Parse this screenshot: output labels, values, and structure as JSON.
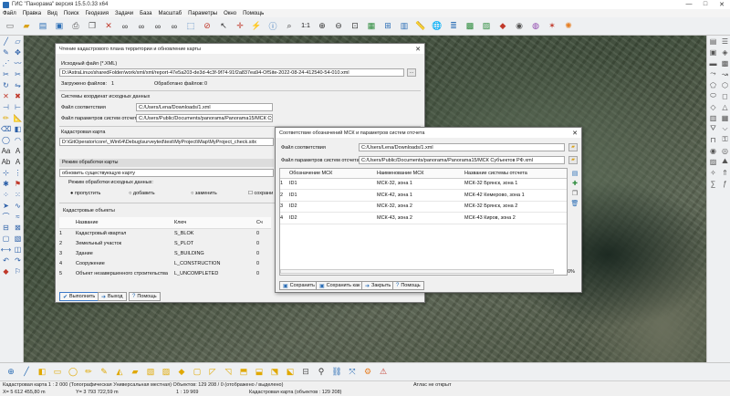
{
  "window": {
    "title": "ГИС \"Панорама\" версия 15.5.0.33 x64",
    "controls": [
      "—",
      "□",
      "✕"
    ]
  },
  "menu": [
    "Файл",
    "Правка",
    "Вид",
    "Поиск",
    "Геодезия",
    "Задачи",
    "База",
    "Масштаб",
    "Параметры",
    "Окно",
    "Помощь"
  ],
  "toolbar": {
    "scale_label": "1:1"
  },
  "dialog1": {
    "title": "Чтение кадастрового плана территории и обновление карты",
    "source_files_label": "Исходный файл (*.XML)",
    "source_file_value": "D:/AstraLinux/sharedFolder/work/xml/xml/report-47e5a203-de3d-4c3f-9f74-91f2a837ea94-OfSite-2022-08-24-412540-54-010.xml",
    "loaded_files_label": "Загружено файлов:",
    "loaded_files_value": "1",
    "processed_files_label": "Обработано файлов:",
    "processed_files_value": "0",
    "crs_section": "Системы координат исходных данных",
    "match_file_label": "Файл соответствия",
    "match_file_value": "C:/Users/Lena/Downloads/1.xml",
    "params_file_label": "Файл параметров систем отсчета",
    "params_file_value": "C:/Users/Public/Documents/panorama/Panorama15/МСК Субъектов РФ.xml",
    "cadastral_map_label": "Кадастровая карта",
    "cadastral_map_value": "D:\\GitOperator\\core\\_Win64\\Debug\\surveyted\\test\\MyProject\\Map\\MyProject_check.sitx",
    "mode_section": "Режим обработки карты",
    "mode_value": "обновить существующую карту",
    "source_mode_label": "Режим обработки исходных данных:",
    "radio_skip": "пропустить",
    "radio_add": "добавить",
    "radio_replace": "заменить",
    "radio_keep": "сохрани",
    "objects_section": "Кадастровые объекты",
    "columns": [
      "Название",
      "Ключ",
      "Сч"
    ],
    "rows": [
      [
        "1",
        "Кадастровый квартал",
        "S_BLOK",
        "0"
      ],
      [
        "2",
        "Земельный участок",
        "S_PLOT",
        "0"
      ],
      [
        "3",
        "Здание",
        "S_BUILDING",
        "0"
      ],
      [
        "4",
        "Сооружение",
        "L_CONSTRUCTION",
        "0"
      ],
      [
        "5",
        "Объект незавершенного строительства",
        "L_UNCOMPLETED",
        "0"
      ]
    ],
    "btn_run": "Выполнить",
    "btn_exit": "Выход",
    "btn_help": "Помощь"
  },
  "dialog2": {
    "title": "Соответствие обозначений МСК и параметров систем отсчета",
    "match_file_label": "Файл соответствия",
    "match_file_value": "C:/Users/Lena/Downloads/1.xml",
    "params_file_label": "Файл параметров систем отсчета",
    "params_file_value": "C:/Users/Public/Documents/panorama/Panorama15/МСК Субъектов РФ.xml",
    "columns": [
      "Обозначение МСК",
      "Наименование МСК",
      "Название системы отсчета"
    ],
    "rows": [
      [
        "1",
        "ID1",
        "МСК-32, зона 1",
        "МСК-32 Брянск, зона 1"
      ],
      [
        "2",
        "ID1",
        "МСК-42, зона 1",
        "МСК-42 Кемерово, зона 1"
      ],
      [
        "3",
        "ID2",
        "МСК-32, зона 2",
        "МСК-32 Брянск, зона 2"
      ],
      [
        "4",
        "ID2",
        "МСК-43, зона 2",
        "МСК-43 Киров, зона 2"
      ]
    ],
    "progress": "0%",
    "btn_save": "Сохранить",
    "btn_save_as": "Сохранить как",
    "btn_close": "Закрыть",
    "btn_help": "Помощь"
  },
  "status": {
    "line1": "Кадастровая карта   1 : 2 000 (Топографическая Универсальная местная) Объектов: 129 208 / 0 (отображено / выделено)",
    "atlas": "Атлас не открыт",
    "x_coord": "X= 5 612 455,80 m",
    "y_coord": "Y= 3 793 722,59 m",
    "scale": "1 : 19 969",
    "map_info": "Кадастровая карта  (объектов : 129 208)"
  }
}
